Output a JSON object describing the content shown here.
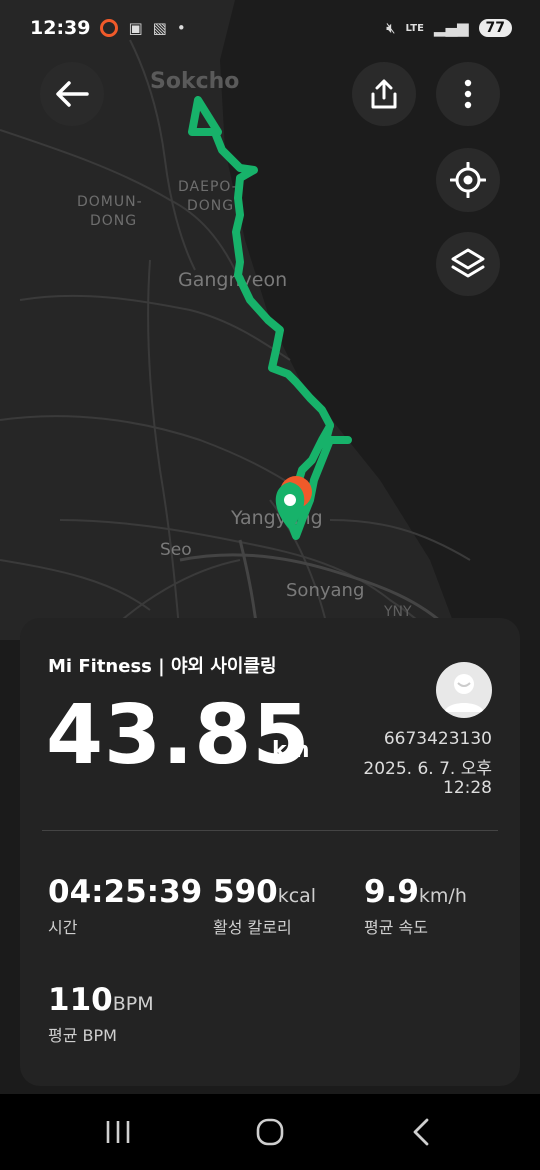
{
  "status_bar": {
    "time": "12:39",
    "network": "LTE",
    "battery": "77"
  },
  "map": {
    "place_labels": [
      "Sokcho",
      "DOMUN-",
      "DONG",
      "DAEPO-",
      "DONG",
      "Gangnyeon",
      "Yangyang",
      "Seo",
      "Sonyang",
      "YNY"
    ],
    "route_color": "#17b26a",
    "end_marker_color": "#f05a2a"
  },
  "toolbar": {
    "back_icon": "arrow-left-icon",
    "share_icon": "share-icon",
    "more_icon": "more-vertical-icon",
    "locate_icon": "crosshair-icon",
    "layers_icon": "layers-icon"
  },
  "summary": {
    "app_title": "Mi Fitness | 야외 사이클링",
    "distance": "43.85",
    "distance_unit": "km",
    "user_id": "6673423130",
    "date_line1": "2025. 6. 7. 오후",
    "date_line2": "12:28",
    "stats": [
      {
        "value": "04:25:39",
        "unit": "",
        "label": "시간"
      },
      {
        "value": "590",
        "unit": "kcal",
        "label": "활성 칼로리"
      },
      {
        "value": "9.9",
        "unit": "km/h",
        "label": "평균 속도"
      },
      {
        "value": "110",
        "unit": "BPM",
        "label": "평균 BPM"
      }
    ]
  }
}
